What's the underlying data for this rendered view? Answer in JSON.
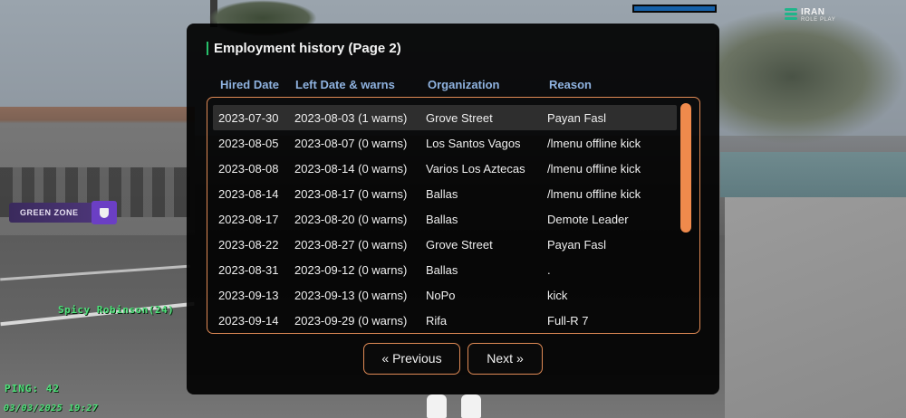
{
  "dialog": {
    "title": "Employment history (Page 2)",
    "columns": [
      "Hired Date",
      "Left Date & warns",
      "Organization",
      "Reason"
    ],
    "rows": [
      {
        "hired": "2023-07-30",
        "left": "2023-08-03 (1 warns)",
        "org": "Grove Street",
        "reason": "Payan Fasl"
      },
      {
        "hired": "2023-08-05",
        "left": "2023-08-07 (0 warns)",
        "org": "Los Santos Vagos",
        "reason": "/lmenu offline kick"
      },
      {
        "hired": "2023-08-08",
        "left": "2023-08-14 (0 warns)",
        "org": "Varios Los Aztecas",
        "reason": "/lmenu offline kick"
      },
      {
        "hired": "2023-08-14",
        "left": "2023-08-17 (0 warns)",
        "org": "Ballas",
        "reason": "/lmenu offline kick"
      },
      {
        "hired": "2023-08-17",
        "left": "2023-08-20 (0 warns)",
        "org": "Ballas",
        "reason": "Demote Leader"
      },
      {
        "hired": "2023-08-22",
        "left": "2023-08-27 (0 warns)",
        "org": "Grove Street",
        "reason": "Payan Fasl"
      },
      {
        "hired": "2023-08-31",
        "left": "2023-09-12 (0 warns)",
        "org": "Ballas",
        "reason": "."
      },
      {
        "hired": "2023-09-13",
        "left": "2023-09-13 (0 warns)",
        "org": "NoPo",
        "reason": "kick"
      },
      {
        "hired": "2023-09-14",
        "left": "2023-09-29 (0 warns)",
        "org": "Rifa",
        "reason": "Full-R 7"
      }
    ],
    "selected_row": 0,
    "prev_label": "« Previous",
    "next_label": "Next »"
  },
  "hud": {
    "logo_line1": "IRAN",
    "logo_line2": "ROLE PLAY",
    "zone_label": "GREEN ZONE",
    "player_name": "Spicy Robinson(24)",
    "ping": "PING: 42",
    "datetime": "03/03/2025 19:27",
    "health_bar_color": "#1560a8"
  },
  "colors": {
    "accent_border": "#e08a55",
    "column_header": "#8fb3e0",
    "title_accent": "#27c06a",
    "hud_text": "#4fe07a"
  }
}
